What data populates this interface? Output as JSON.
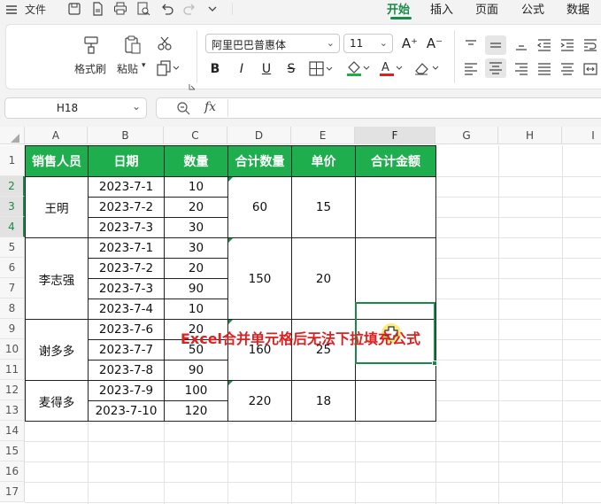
{
  "menubar": {
    "file_label": "文件",
    "tabs": [
      "开始",
      "插入",
      "页面",
      "公式",
      "数据"
    ],
    "active_tab": "开始"
  },
  "ribbon": {
    "format_painter_label": "格式刷",
    "paste_label": "粘贴",
    "font_name": "阿里巴巴普惠体",
    "font_size": "11",
    "bold": "B",
    "italic": "I",
    "underline": "U",
    "strike": "S",
    "increase_font": "A⁺",
    "decrease_font": "A⁻",
    "font_color_bar": "#e02020",
    "fill_color_bar": "#1fae4d"
  },
  "formula_bar": {
    "name_box": "H18",
    "fx_label": "fx",
    "formula": ""
  },
  "grid": {
    "columns": [
      "A",
      "B",
      "C",
      "D",
      "E",
      "F",
      "G",
      "H",
      "I"
    ],
    "rows": [
      "1",
      "2",
      "3",
      "4",
      "5",
      "6",
      "7",
      "8",
      "9",
      "10",
      "11",
      "12",
      "13",
      "14",
      "15",
      "16",
      "17"
    ],
    "headers": [
      "销售人员",
      "日期",
      "数量",
      "合计数量",
      "单价",
      "合计金额"
    ],
    "groups": [
      {
        "name": "王明",
        "total": "60",
        "price": "15",
        "amount": "",
        "rows": [
          {
            "date": "2023-7-1",
            "qty": "10"
          },
          {
            "date": "2023-7-2",
            "qty": "20"
          },
          {
            "date": "2023-7-3",
            "qty": "30"
          }
        ]
      },
      {
        "name": "李志强",
        "total": "150",
        "price": "20",
        "amount": "",
        "rows": [
          {
            "date": "2023-7-1",
            "qty": "30"
          },
          {
            "date": "2023-7-2",
            "qty": "20"
          },
          {
            "date": "2023-7-3",
            "qty": "90"
          },
          {
            "date": "2023-7-4",
            "qty": "10"
          }
        ]
      },
      {
        "name": "谢多多",
        "total": "160",
        "price": "25",
        "amount": "",
        "rows": [
          {
            "date": "2023-7-6",
            "qty": "20"
          },
          {
            "date": "2023-7-7",
            "qty": "50"
          },
          {
            "date": "2023-7-8",
            "qty": "90"
          }
        ]
      },
      {
        "name": "麦得多",
        "total": "220",
        "price": "18",
        "amount": "",
        "rows": [
          {
            "date": "2023-7-9",
            "qty": "100"
          },
          {
            "date": "2023-7-10",
            "qty": "120"
          }
        ]
      }
    ]
  },
  "caption": "Excel合并单元格后无法下拉填充公式",
  "colors": {
    "accent": "#1a8a4a",
    "header_fill": "#1fae4d",
    "caption": "#e02020"
  }
}
